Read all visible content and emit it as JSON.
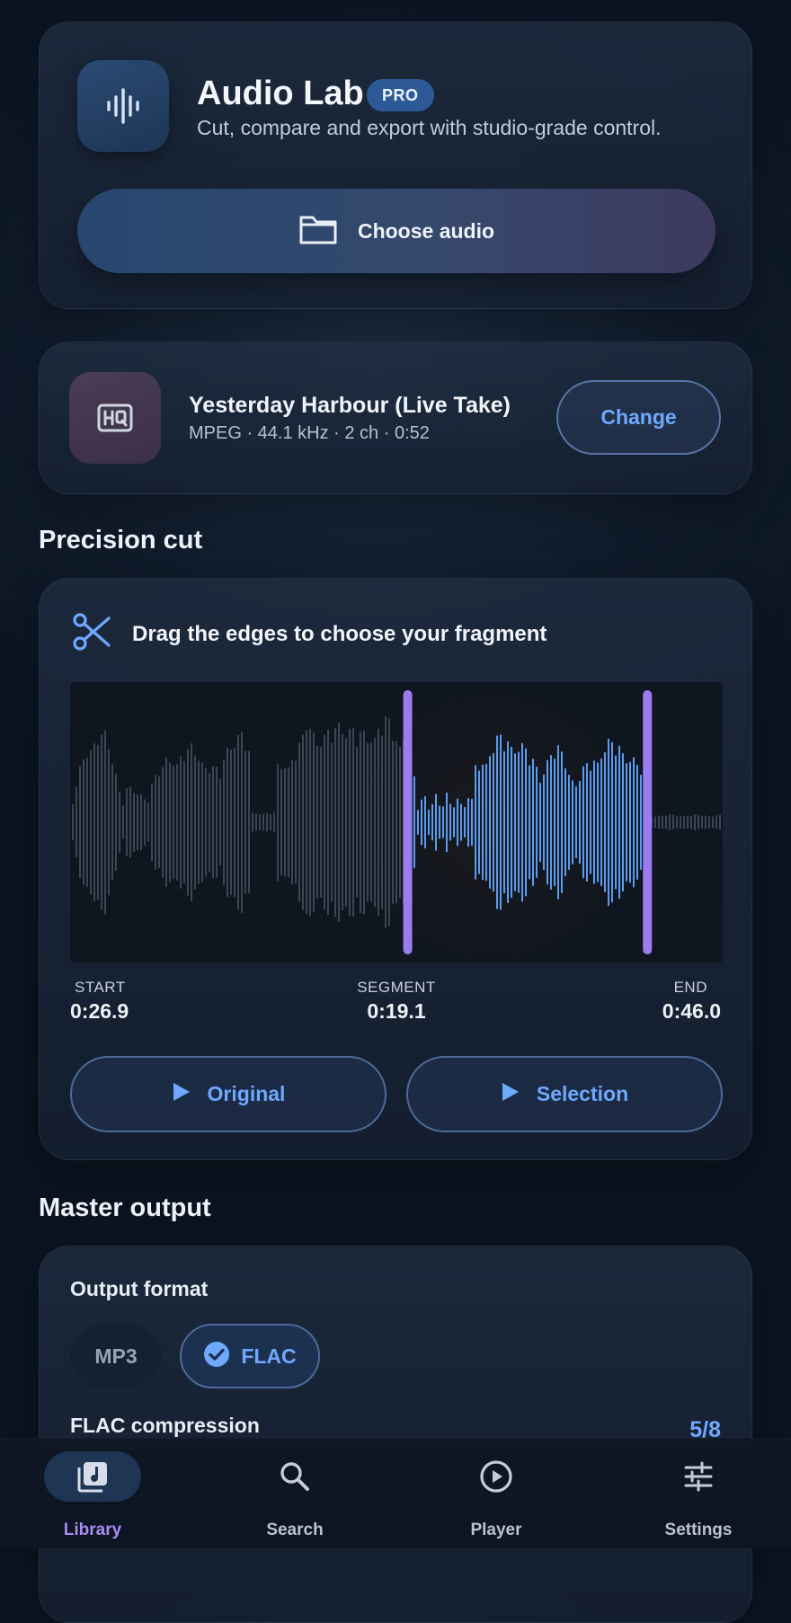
{
  "header": {
    "app_title": "Audio Lab",
    "badge": "PRO",
    "subtitle": "Cut, compare and export with studio-grade control.",
    "choose_button": "Choose audio",
    "icons": {
      "app": "waveform-icon",
      "choose": "folder-icon"
    }
  },
  "file": {
    "icon": "hq-icon",
    "name": "Yesterday Harbour (Live Take)",
    "meta": "MPEG · 44.1 kHz · 2 ch · 0:52",
    "change_button": "Change"
  },
  "cut": {
    "section_title": "Precision cut",
    "instruction": "Drag the edges to choose your fragment",
    "icon": "scissors-icon",
    "start_label": "START",
    "start_value": "0:26.9",
    "segment_label": "SEGMENT",
    "segment_value": "0:19.1",
    "end_label": "END",
    "end_value": "0:46.0",
    "duration_seconds": 52,
    "selection_start_seconds": 26.9,
    "selection_end_seconds": 46.0,
    "original_button": "Original",
    "selection_button": "Selection"
  },
  "output": {
    "section_title": "Master output",
    "format_label": "Output format",
    "formats": [
      "MP3",
      "FLAC"
    ],
    "selected_format": "FLAC",
    "compression_label": "FLAC compression",
    "compression_value": "5/8"
  },
  "nav": {
    "items": [
      {
        "label": "Library",
        "icon": "library-icon",
        "active": true
      },
      {
        "label": "Search",
        "icon": "search-icon",
        "active": false
      },
      {
        "label": "Player",
        "icon": "play-circle-icon",
        "active": false
      },
      {
        "label": "Settings",
        "icon": "sliders-icon",
        "active": false
      }
    ]
  },
  "colors": {
    "accent_blue": "#6ea8ff",
    "accent_purple": "#a98bf2",
    "handle": "#9b7cf0",
    "wave_selected": "#5b9cf0",
    "wave_unselected": "#3b4655"
  }
}
